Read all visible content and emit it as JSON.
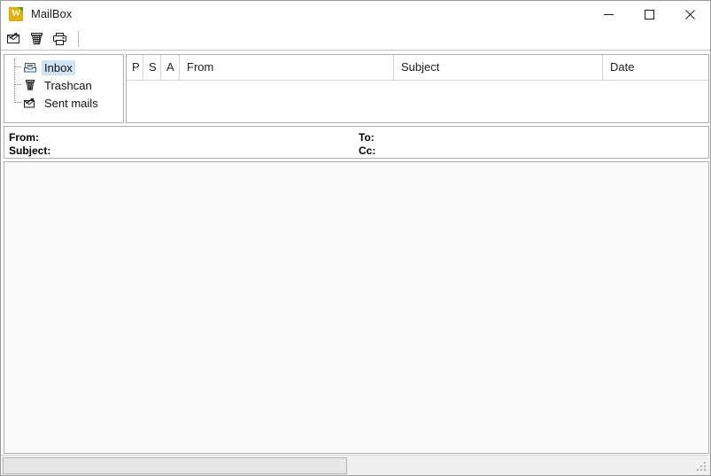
{
  "window": {
    "title": "MailBox",
    "app_icon": "mailbox-app-icon",
    "icon_letter": "W",
    "controls": {
      "minimize": "minimize-button",
      "maximize": "maximize-button",
      "close": "close-button"
    }
  },
  "toolbar": {
    "buttons": [
      {
        "name": "new-mail-icon",
        "tooltip": "New mail"
      },
      {
        "name": "delete-mail-icon",
        "tooltip": "Delete"
      },
      {
        "name": "print-icon",
        "tooltip": "Print"
      }
    ]
  },
  "sidebar": {
    "items": [
      {
        "label": "Inbox",
        "icon": "inbox-tray-icon",
        "selected": true
      },
      {
        "label": "Trashcan",
        "icon": "trashcan-icon",
        "selected": false
      },
      {
        "label": "Sent mails",
        "icon": "sent-mail-icon",
        "selected": false
      }
    ]
  },
  "message_list": {
    "columns": [
      {
        "key": "p",
        "label": "P"
      },
      {
        "key": "s",
        "label": "S"
      },
      {
        "key": "a",
        "label": "A"
      },
      {
        "key": "from",
        "label": "From"
      },
      {
        "key": "subject",
        "label": "Subject"
      },
      {
        "key": "date",
        "label": "Date"
      }
    ],
    "rows": []
  },
  "message_headers": {
    "from_label": "From:",
    "from_value": "",
    "subject_label": "Subject:",
    "subject_value": "",
    "to_label": "To:",
    "to_value": "",
    "cc_label": "Cc:",
    "cc_value": ""
  },
  "message_body": {
    "text": ""
  },
  "statusbar": {
    "text": "",
    "grip": "resize-grip"
  },
  "colors": {
    "selection": "#cfe4f7",
    "app_icon_bg": "#e2b10f",
    "app_icon_corner": "#5aa02c",
    "panel_border": "#aeaeae",
    "window_bg": "#ffffff",
    "status_bg": "#f0f0f0"
  }
}
